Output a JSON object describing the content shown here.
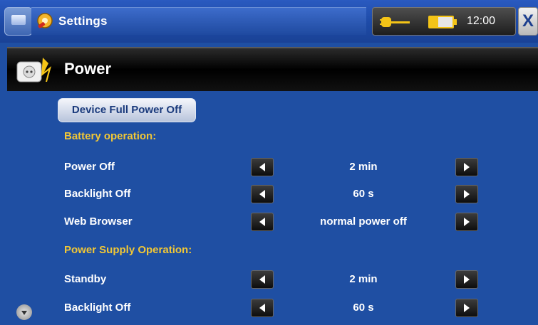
{
  "window": {
    "title": "Settings",
    "time": "12:00",
    "close_label": "X"
  },
  "icons": {
    "home": "device-home-icon",
    "settings": "settings-icon",
    "plug": "plug-icon",
    "battery": "battery-icon",
    "power": "power-socket-icon",
    "scroll": "scroll-down-icon"
  },
  "colors": {
    "background": "#1f4fa3",
    "group_label": "#f1c736",
    "header_bar": "#000000"
  },
  "section": {
    "title": "Power"
  },
  "full_power_off": {
    "label": "Device Full Power Off"
  },
  "groups": [
    {
      "label": "Battery operation:"
    },
    {
      "label": "Power Supply Operation:"
    }
  ],
  "rows": [
    {
      "label": "Power Off",
      "value": "2 min"
    },
    {
      "label": "Backlight Off",
      "value": "60 s"
    },
    {
      "label": "Web Browser",
      "value": "normal power off"
    },
    {
      "label": "Standby",
      "value": "2 min"
    },
    {
      "label": "Backlight Off",
      "value": "60 s"
    }
  ]
}
